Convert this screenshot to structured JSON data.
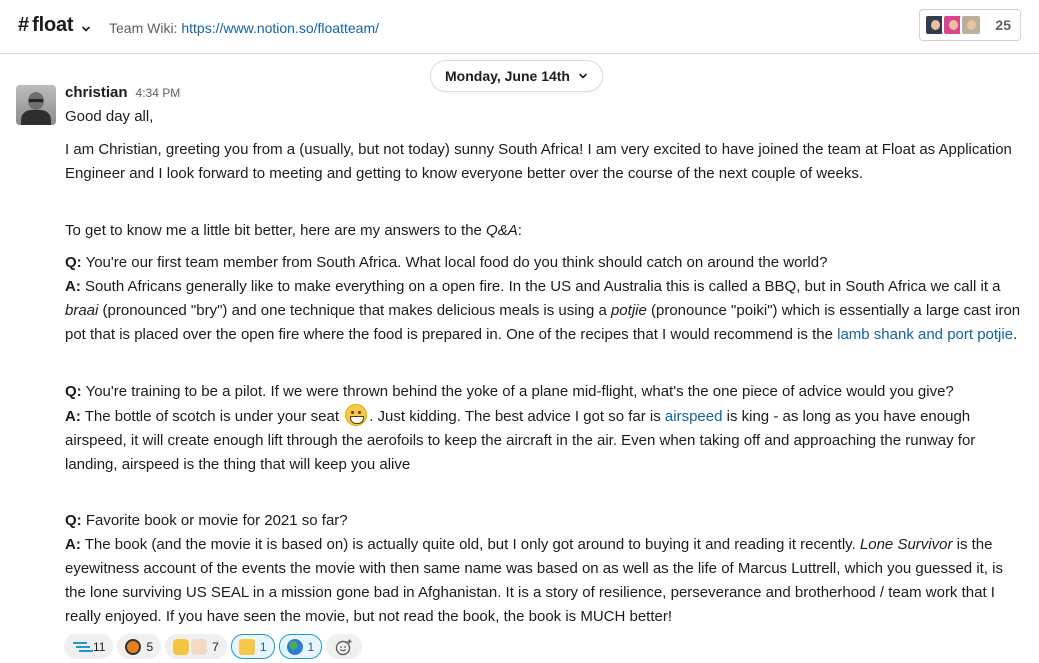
{
  "header": {
    "hash": "#",
    "channel_name": "float",
    "topic_label": "Team Wiki:",
    "topic_link": "https://www.notion.so/floatteam/",
    "member_count": "25"
  },
  "date_divider": {
    "label": "Monday, June 14th"
  },
  "message": {
    "sender": "christian",
    "time": "4:34 PM",
    "greeting": "Good day all,",
    "intro": "I am Christian, greeting you from a (usually, but not today) sunny South Africa! I am very excited to have joined the team at Float as Application Engineer and I look forward to meeting and getting to know everyone better over the course of the next couple of weeks.",
    "qa_intro_a": "To get to know me a little bit better, here are my answers to the ",
    "qa_intro_em": "Q&A",
    "qa_intro_b": ":",
    "q_label": "Q:",
    "a_label": "A:",
    "q1": " You're our first team member from South Africa. What local food do you think should catch on around the world?",
    "a1_part1": " South Africans generally like to make everything on a open fire. In the US and Australia this is called a BBQ, but in South Africa we call it a ",
    "a1_braai": "braai",
    "a1_part2": " (pronounced \"bry\") and one technique that makes delicious meals is using a ",
    "a1_potjie": "potjie",
    "a1_part3": " (pronounce \"poiki\") which is essentially a large cast iron pot that is placed over the open fire where the food is prepared in. One of the recipes that I would recommend is the ",
    "a1_link": "lamb shank and port potjie",
    "a1_part4": ".",
    "q2": " You're training to be a pilot. If we were thrown behind the yoke of a plane mid-flight, what's the one piece of advice would you give?",
    "a2_part1": " The bottle of scotch is under your seat ",
    "a2_part2": ". Just kidding.  The best advice I got so far is ",
    "a2_link": "airspeed",
    "a2_part3": " is king - as long as you have enough airspeed, it will create enough lift through the aerofoils to keep the aircraft in the air. Even when taking off and approaching the runway for landing, airspeed is the thing that will keep you alive",
    "q3": " Favorite book or movie for 2021 so far?",
    "a3_part1": " The book (and the movie it is based on) is actually quite old, but I only got around to buying it and reading it recently. ",
    "a3_title": "Lone Survivor",
    "a3_part2": " is the eyewitness account of the events the movie with then same name was based on as well as the life of Marcus Luttrell, which you guessed it, is the lone surviving US SEAL in a mission gone bad in Afghanistan. It is a story of resilience, perseverance and brotherhood / team work that I really enjoyed. If you have seen the movie, but not read the book, the book is MUCH better!"
  },
  "reactions": [
    {
      "icon": "lines-icon",
      "count": "11"
    },
    {
      "icon": "ball-icon",
      "count": "5"
    },
    {
      "icon": "clap-icon",
      "count": "7"
    },
    {
      "icon": "raised-hands-icon",
      "count": "1"
    },
    {
      "icon": "globe-icon",
      "count": "1"
    }
  ],
  "colors": {
    "link": "#1264a3",
    "reaction_selected_border": "#1d9bd1"
  }
}
